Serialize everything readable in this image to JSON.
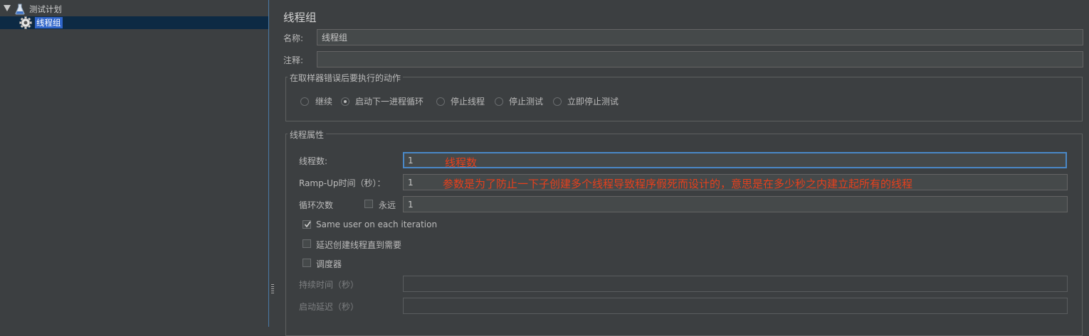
{
  "tree": {
    "plan_label": "测试计划",
    "thread_group_label": "线程组"
  },
  "panel": {
    "title": "线程组",
    "name_label": "名称:",
    "name_value": "线程组",
    "comment_label": "注释:",
    "comment_value": ""
  },
  "error_action": {
    "title": "在取样器错误后要执行的动作",
    "options": [
      "继续",
      "启动下一进程循环",
      "停止线程",
      "停止测试",
      "立即停止测试"
    ],
    "selected": "启动下一进程循环"
  },
  "thread_props": {
    "title": "线程属性",
    "num_threads_label": "线程数:",
    "num_threads_value": "1",
    "num_threads_note": "线程数",
    "rampup_label": "Ramp-Up时间（秒）：",
    "rampup_value": "1",
    "rampup_note": "参数是为了防止一下子创建多个线程导致程序假死而设计的，意思是在多少秒之内建立起所有的线程",
    "loop_label": "循环次数",
    "forever_label": "永远",
    "forever_checked": false,
    "loop_value": "1",
    "same_user_label": "Same user on each iteration",
    "same_user_checked": true,
    "delay_label": "延迟创建线程直到需要",
    "delay_checked": false,
    "scheduler_label": "调度器",
    "scheduler_checked": false,
    "duration_label": "持续时间（秒）",
    "duration_value": "",
    "startup_delay_label": "启动延迟（秒）",
    "startup_delay_value": ""
  }
}
